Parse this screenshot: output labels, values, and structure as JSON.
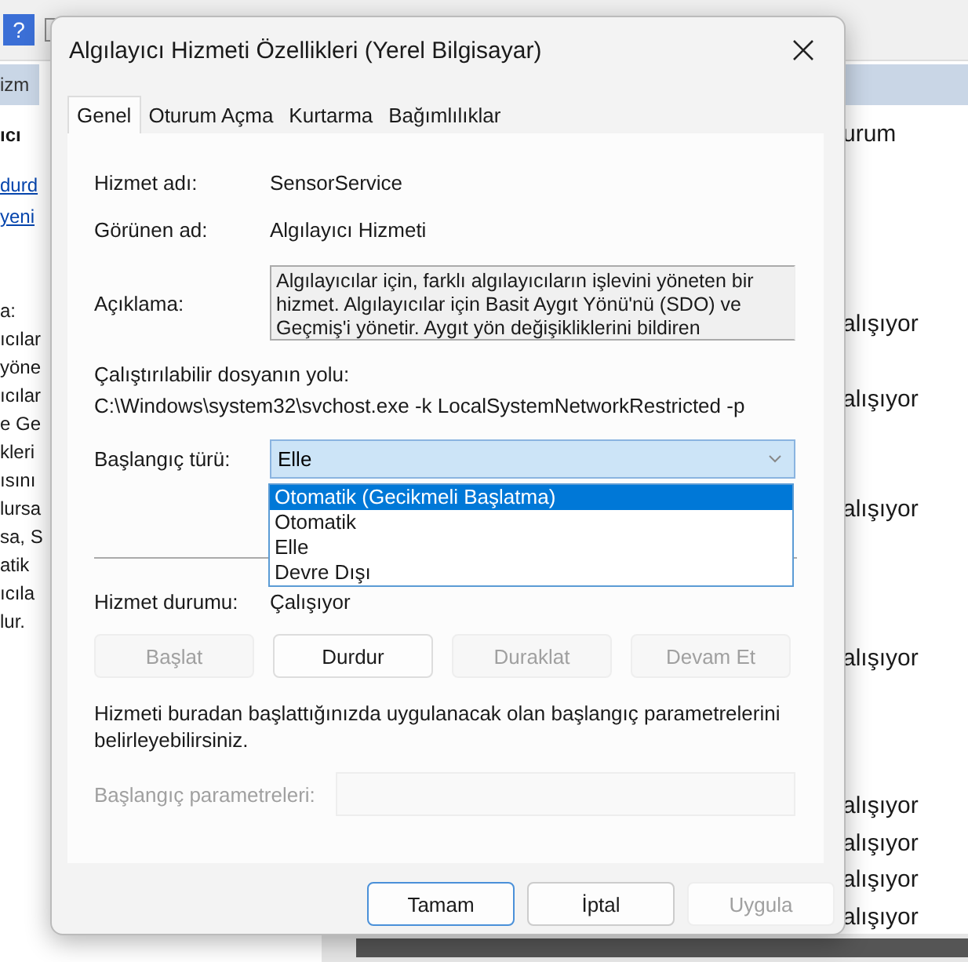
{
  "background_window": {
    "toolbar": {
      "help_glyph": "?"
    },
    "left_pane": {
      "header": "izm",
      "title": "ıcı",
      "links": [
        "durd",
        "yeni"
      ],
      "description_lines": [
        "a:",
        "ıcılar",
        "yöne",
        "ıcılar",
        "e Ge",
        "kleri",
        "ısını",
        "lursa",
        "sa, S",
        "atik",
        "ıcıla",
        "lur."
      ]
    },
    "list": {
      "column_header": "urum",
      "statuses": [
        "alışıyor",
        "alışıyor",
        "alışıyor",
        "alışıyor",
        "alışıyor",
        "alışıyor",
        "alışıyor",
        "alışıyor"
      ]
    }
  },
  "dialog": {
    "title": "Algılayıcı Hizmeti Özellikleri (Yerel Bilgisayar)",
    "tabs": [
      {
        "label": "Genel",
        "selected": true
      },
      {
        "label": "Oturum Açma",
        "selected": false
      },
      {
        "label": "Kurtarma",
        "selected": false
      },
      {
        "label": "Bağımlılıklar",
        "selected": false
      }
    ],
    "service_name": {
      "label": "Hizmet adı:",
      "value": "SensorService"
    },
    "display_name": {
      "label": "Görünen ad:",
      "value": "Algılayıcı Hizmeti"
    },
    "description": {
      "label": "Açıklama:",
      "value": "Algılayıcılar için, farklı algılayıcıların işlevini yöneten bir hizmet. Algılayıcılar için Basit Aygıt Yönü'nü (SDO) ve Geçmiş'i yönetir. Aygıt yön değişikliklerini bildiren"
    },
    "executable_path": {
      "label": "Çalıştırılabilir dosyanın yolu:",
      "value": "C:\\Windows\\system32\\svchost.exe -k LocalSystemNetworkRestricted -p"
    },
    "startup_type": {
      "label": "Başlangıç türü:",
      "value": "Elle",
      "expanded": true,
      "options": [
        {
          "label": "Otomatik (Gecikmeli Başlatma)",
          "highlighted": true
        },
        {
          "label": "Otomatik",
          "highlighted": false
        },
        {
          "label": "Elle",
          "highlighted": false
        },
        {
          "label": "Devre Dışı",
          "highlighted": false
        }
      ]
    },
    "service_status": {
      "label": "Hizmet durumu:",
      "value": "Çalışıyor"
    },
    "service_buttons": [
      {
        "label": "Başlat",
        "disabled": true
      },
      {
        "label": "Durdur",
        "disabled": false
      },
      {
        "label": "Duraklat",
        "disabled": true
      },
      {
        "label": "Devam Et",
        "disabled": true
      }
    ],
    "hint": "Hizmeti buradan başlattığınızda uygulanacak olan başlangıç parametrelerini belirleyebilirsiniz.",
    "start_parameters": {
      "label": "Başlangıç parametreleri:",
      "disabled": true
    },
    "buttons": [
      {
        "label": "Tamam",
        "default": true,
        "disabled": false
      },
      {
        "label": "İptal",
        "default": false,
        "disabled": false
      },
      {
        "label": "Uygula",
        "default": false,
        "disabled": true
      }
    ]
  }
}
